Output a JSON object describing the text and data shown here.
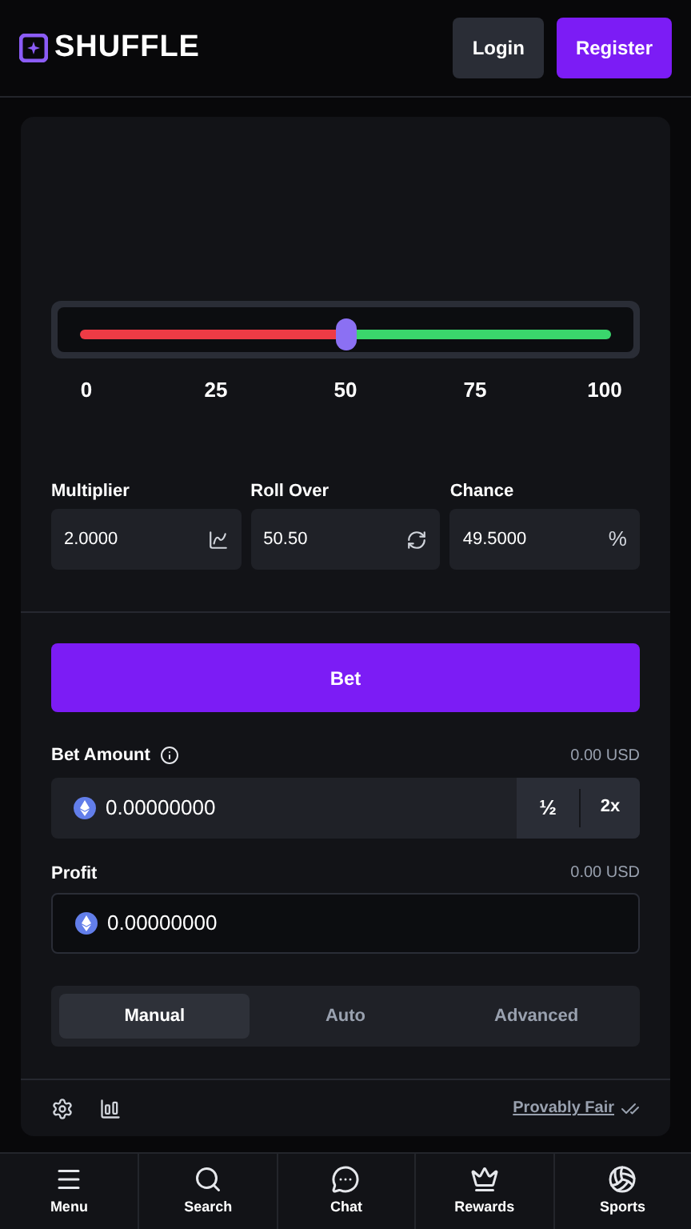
{
  "header": {
    "logo": "SHUFFLE",
    "login": "Login",
    "register": "Register"
  },
  "slider": {
    "level": 0.5,
    "ticks": [
      "0",
      "25",
      "50",
      "75",
      "100"
    ]
  },
  "fields": [
    {
      "label": "Multiplier",
      "value": "2.0000",
      "kind": "chart"
    },
    {
      "label": "Roll Over",
      "value": "50.50",
      "kind": "swap"
    },
    {
      "label": "Chance",
      "value": "49.5000",
      "kind": "percent",
      "suffix": "%"
    }
  ],
  "bet_button": "Bet",
  "bet_amount": {
    "label": "Bet Amount",
    "usd": "0.00 USD",
    "value": "0.00000000",
    "half": "½",
    "double": "2x"
  },
  "profit": {
    "label": "Profit",
    "usd": "0.00 USD",
    "value": "0.00000000"
  },
  "modes": [
    {
      "label": "Manual",
      "selected": true
    },
    {
      "label": "Auto",
      "selected": false
    },
    {
      "label": "Advanced",
      "selected": false
    }
  ],
  "footer": {
    "link": "Provably Fair"
  },
  "nav": [
    {
      "label": "Menu",
      "kind": "menu"
    },
    {
      "label": "Search",
      "kind": "search"
    },
    {
      "label": "Chat",
      "kind": "chat"
    },
    {
      "label": "Rewards",
      "kind": "crown"
    },
    {
      "label": "Sports",
      "kind": "ball"
    }
  ]
}
